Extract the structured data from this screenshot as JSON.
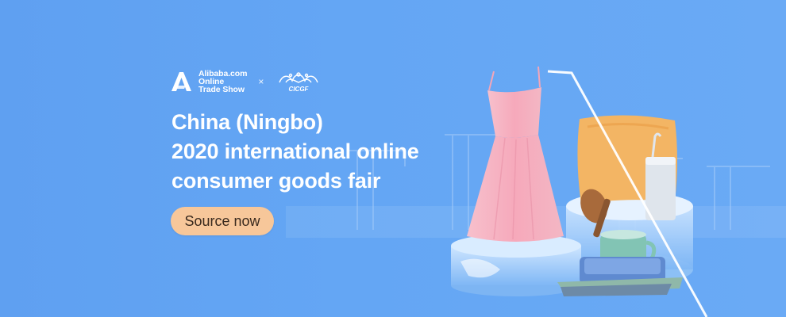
{
  "banner": {
    "brand": {
      "line1": "Alibaba.com",
      "line2": "Online",
      "line3": "Trade Show",
      "separator": "×",
      "partner_logo_text": "CICGF"
    },
    "headline": {
      "line1": "China (Ningbo)",
      "line2": "2020 international online",
      "line3": "consumer goods fair"
    },
    "cta_label": "Source now",
    "colors": {
      "background": "#62a3f2",
      "cta": "#f7c79a",
      "dress": "#f6b4c1",
      "pillow": "#f3b564"
    },
    "icons": [
      "alibaba-logo-icon",
      "cicgf-logo-icon"
    ]
  }
}
